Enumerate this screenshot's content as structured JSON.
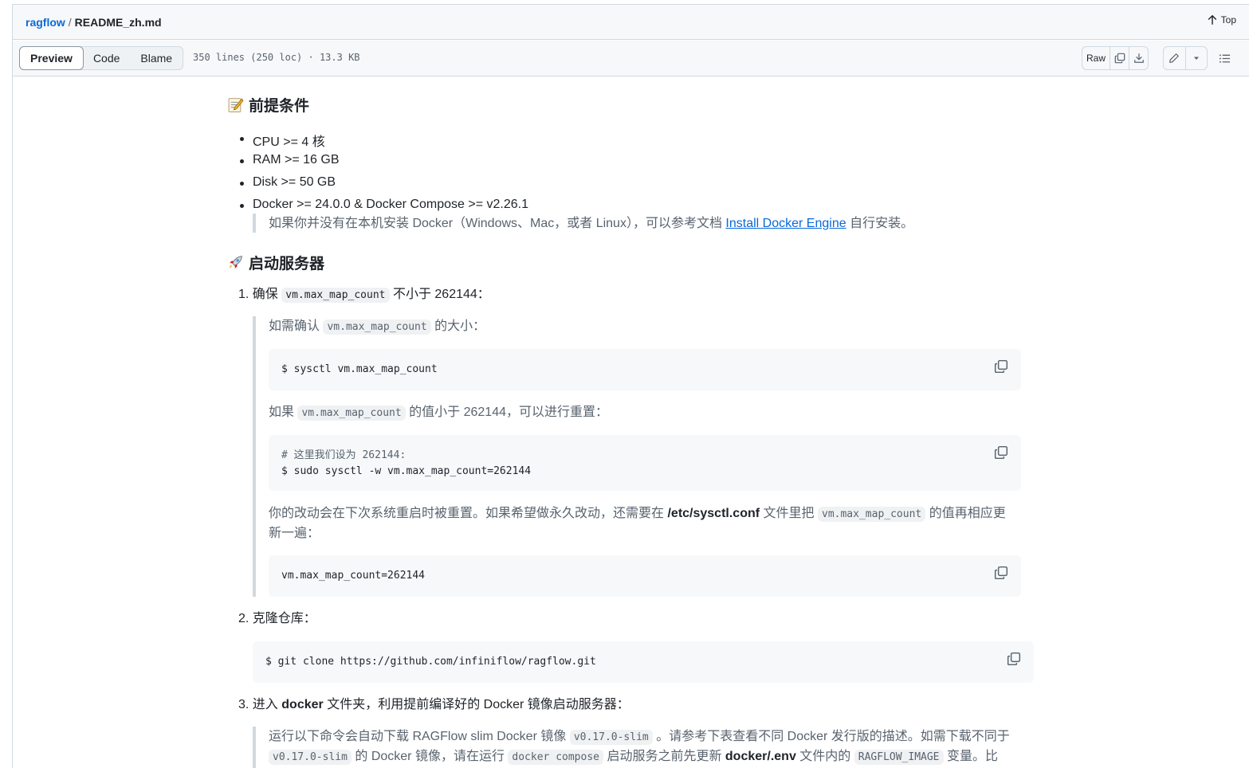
{
  "breadcrumb": {
    "repo": "ragflow",
    "separator": "/",
    "file": "README_zh.md"
  },
  "top_button": {
    "label": "Top",
    "icon": "arrow-up-icon"
  },
  "view_tabs": [
    {
      "label": "Preview",
      "active": true
    },
    {
      "label": "Code",
      "active": false
    },
    {
      "label": "Blame",
      "active": false
    }
  ],
  "file_info": "350 lines (250 loc) · 13.3 KB",
  "toolbar": {
    "raw_label": "Raw"
  },
  "sections": {
    "prereq_heading": "前提条件",
    "prereq_items": [
      "CPU >= 4 核",
      "RAM >= 16 GB",
      "Disk >= 50 GB",
      "Docker >= 24.0.0 & Docker Compose >= v2.26.1"
    ],
    "prereq_note_before": "如果你并没有在本机安装 Docker（Windows、Mac，或者 Linux），可以参考文档",
    "prereq_note_link": "Install Docker Engine",
    "prereq_note_after": "自行安装。",
    "start_heading": "启动服务器"
  },
  "step1": {
    "number": "1.",
    "before": "确保",
    "code": "vm.max_map_count",
    "after": "不小于 262144：",
    "q1_before": "如需确认",
    "q1_code": "vm.max_map_count",
    "q1_after": "的大小：",
    "code1": "$ sysctl vm.max_map_count",
    "q2_before": "如果",
    "q2_code": "vm.max_map_count",
    "q2_after": "的值小于 262144，可以进行重置：",
    "code2_line1": "# 这里我们设为 262144:",
    "code2_line2": "$ sudo sysctl -w vm.max_map_count=262144",
    "q3_before": "你的改动会在下次系统重启时被重置。如果希望做永久改动，还需要在",
    "q3_bold": "/etc/sysctl.conf",
    "q3_mid": "文件里把",
    "q3_code": "vm.max_map_count",
    "q3_after": "的值再相应更",
    "q3_line2": "新一遍：",
    "code3": "vm.max_map_count=262144"
  },
  "step2": {
    "number": "2.",
    "text": "克隆仓库：",
    "code": "$ git clone https://github.com/infiniflow/ragflow.git"
  },
  "step3": {
    "number": "3.",
    "before": "进入",
    "bold": "docker",
    "after": "文件夹，利用提前编译好的 Docker 镜像启动服务器：",
    "q_before": "运行以下命令会自动下载 RAGFlow slim Docker 镜像",
    "q_code1": "v0.17.0-slim",
    "q_mid": "。请参考下表查看不同 Docker 发行版的描述。如需下载不同于",
    "q_code2": "v0.17.0-slim",
    "q_l2a": "的 Docker 镜像，请在运行",
    "q_code3": "docker compose",
    "q_l2b": "启动服务之前先更新",
    "q_bold": "docker/.env",
    "q_l2c": "文件内的",
    "q_code4": "RAGFLOW_IMAGE",
    "q_l2d": "变量。比"
  }
}
